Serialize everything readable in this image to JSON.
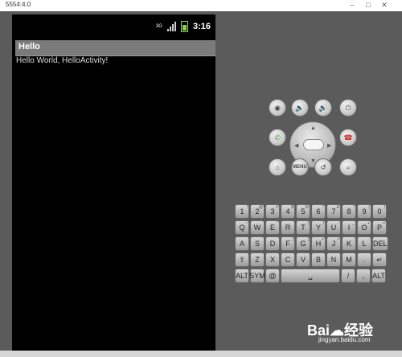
{
  "window": {
    "title": "5554:4.0"
  },
  "statusbar": {
    "time": "3:16",
    "network_label": "3G"
  },
  "app": {
    "title": "Hello",
    "text": "Hello World, HelloActivity!"
  },
  "controls": {
    "menu_label": "MENU"
  },
  "keyboard": {
    "row1": [
      [
        "1",
        "!"
      ],
      [
        "2",
        "@"
      ],
      [
        "3",
        "#"
      ],
      [
        "4",
        "$"
      ],
      [
        "5",
        "%"
      ],
      [
        "6",
        "^"
      ],
      [
        "7",
        "&"
      ],
      [
        "8",
        "*"
      ],
      [
        "9",
        "("
      ],
      [
        "0",
        ")"
      ]
    ],
    "row2": [
      [
        "Q",
        "~"
      ],
      [
        "W",
        ""
      ],
      [
        "E",
        "\""
      ],
      [
        "R",
        ""
      ],
      [
        "T",
        "{"
      ],
      [
        "Y",
        "}"
      ],
      [
        "U",
        "-"
      ],
      [
        "I",
        "_"
      ],
      [
        "O",
        "+"
      ],
      [
        "P",
        "="
      ]
    ],
    "row3": [
      [
        "A",
        ""
      ],
      [
        "S",
        ""
      ],
      [
        "D",
        ""
      ],
      [
        "F",
        "["
      ],
      [
        "G",
        "]"
      ],
      [
        "H",
        "<"
      ],
      [
        "J",
        ">"
      ],
      [
        "K",
        ";"
      ],
      [
        "L",
        ":"
      ],
      [
        "DEL",
        ""
      ]
    ],
    "row4": [
      [
        "⇧",
        ""
      ],
      [
        "Z",
        ""
      ],
      [
        "X",
        ""
      ],
      [
        "C",
        ""
      ],
      [
        "V",
        ""
      ],
      [
        "B",
        ""
      ],
      [
        "N",
        ""
      ],
      [
        "M",
        ""
      ],
      [
        ".",
        ""
      ],
      [
        "↵",
        ""
      ]
    ],
    "row5": [
      [
        "ALT",
        ""
      ],
      [
        "SYM",
        ""
      ],
      [
        "@",
        ""
      ],
      [
        "␣",
        ""
      ],
      [
        "/",
        ""
      ],
      [
        ",",
        ""
      ],
      [
        "ALT",
        ""
      ]
    ]
  },
  "watermark": {
    "logo_text": "Bai☁经验",
    "url": "jingyan.baidu.com"
  }
}
